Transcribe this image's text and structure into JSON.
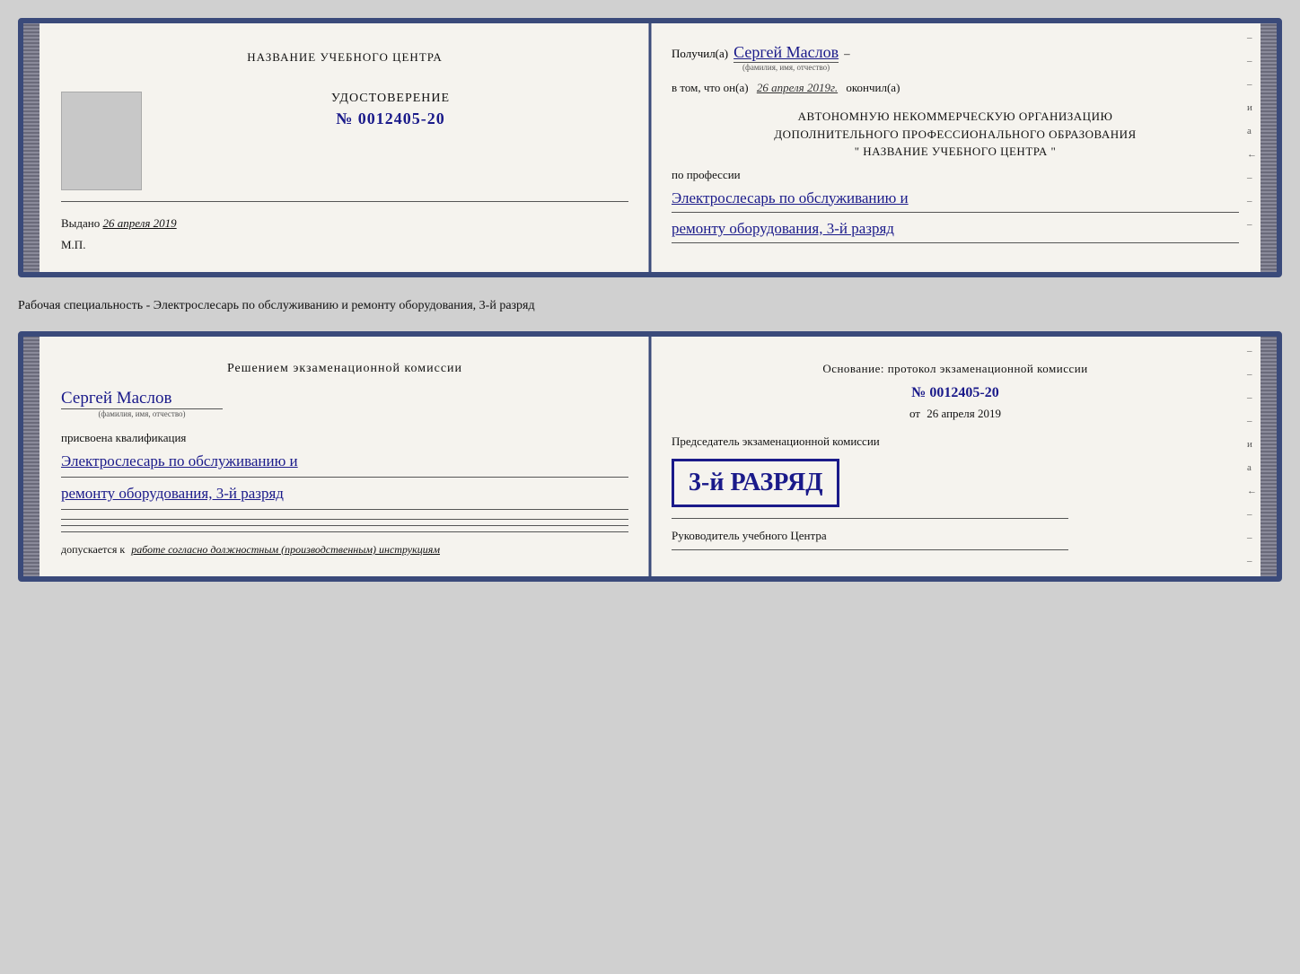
{
  "top_card": {
    "left": {
      "title": "НАЗВАНИЕ УЧЕБНОГО ЦЕНТРА",
      "cert_label": "УДОСТОВЕРЕНИЕ",
      "cert_number": "№ 0012405-20",
      "issued_label": "Выдано",
      "issued_date": "26 апреля 2019",
      "mp_label": "М.П."
    },
    "right": {
      "received_prefix": "Получил(а)",
      "received_name": "Сергей Маслов",
      "name_subtitle": "(фамилия, имя, отчество)",
      "in_that_prefix": "в том, что он(а)",
      "in_that_date": "26 апреля 2019г.",
      "okончил": "окончил(а)",
      "org_line1": "АВТОНОМНУЮ НЕКОММЕРЧЕСКУЮ ОРГАНИЗАЦИЮ",
      "org_line2": "ДОПОЛНИТЕЛЬНОГО ПРОФЕССИОНАЛЬНОГО ОБРАЗОВАНИЯ",
      "org_line3": "\"   НАЗВАНИЕ УЧЕБНОГО ЦЕНТРА   \"",
      "prof_label": "по профессии",
      "prof_value": "Электрослесарь по обслуживанию и",
      "prof_value2": "ремонту оборудования, 3-й разряд",
      "dashes": [
        "–",
        "–",
        "–",
        "и",
        "а",
        "←",
        "–",
        "–",
        "–"
      ]
    }
  },
  "between_label": "Рабочая специальность - Электрослесарь по обслуживанию и ремонту оборудования, 3-й разряд",
  "bottom_card": {
    "left": {
      "decision_title": "Решением экзаменационной комиссии",
      "decision_name": "Сергей Маслов",
      "name_subtitle": "(фамилия, имя, отчество)",
      "assigned_label": "присвоена квалификация",
      "assigned_value": "Электрослесарь по обслуживанию и",
      "assigned_value2": "ремонту оборудования, 3-й разряд",
      "allowed_prefix": "допускается к",
      "allowed_value": "работе согласно должностным (производственным) инструкциям"
    },
    "right": {
      "basis_title": "Основание: протокол экзаменационной комиссии",
      "protocol_number": "№ 0012405-20",
      "protocol_date_prefix": "от",
      "protocol_date": "26 апреля 2019",
      "chairman_label": "Председатель экзаменационной комиссии",
      "stamp_small": "3-й разряд",
      "stamp_large": "3-й РАЗРЯД",
      "rukovoditel_label": "Руководитель учебного Центра",
      "dashes": [
        "–",
        "–",
        "–",
        "–",
        "и",
        "а",
        "←",
        "–",
        "–",
        "–"
      ]
    }
  }
}
